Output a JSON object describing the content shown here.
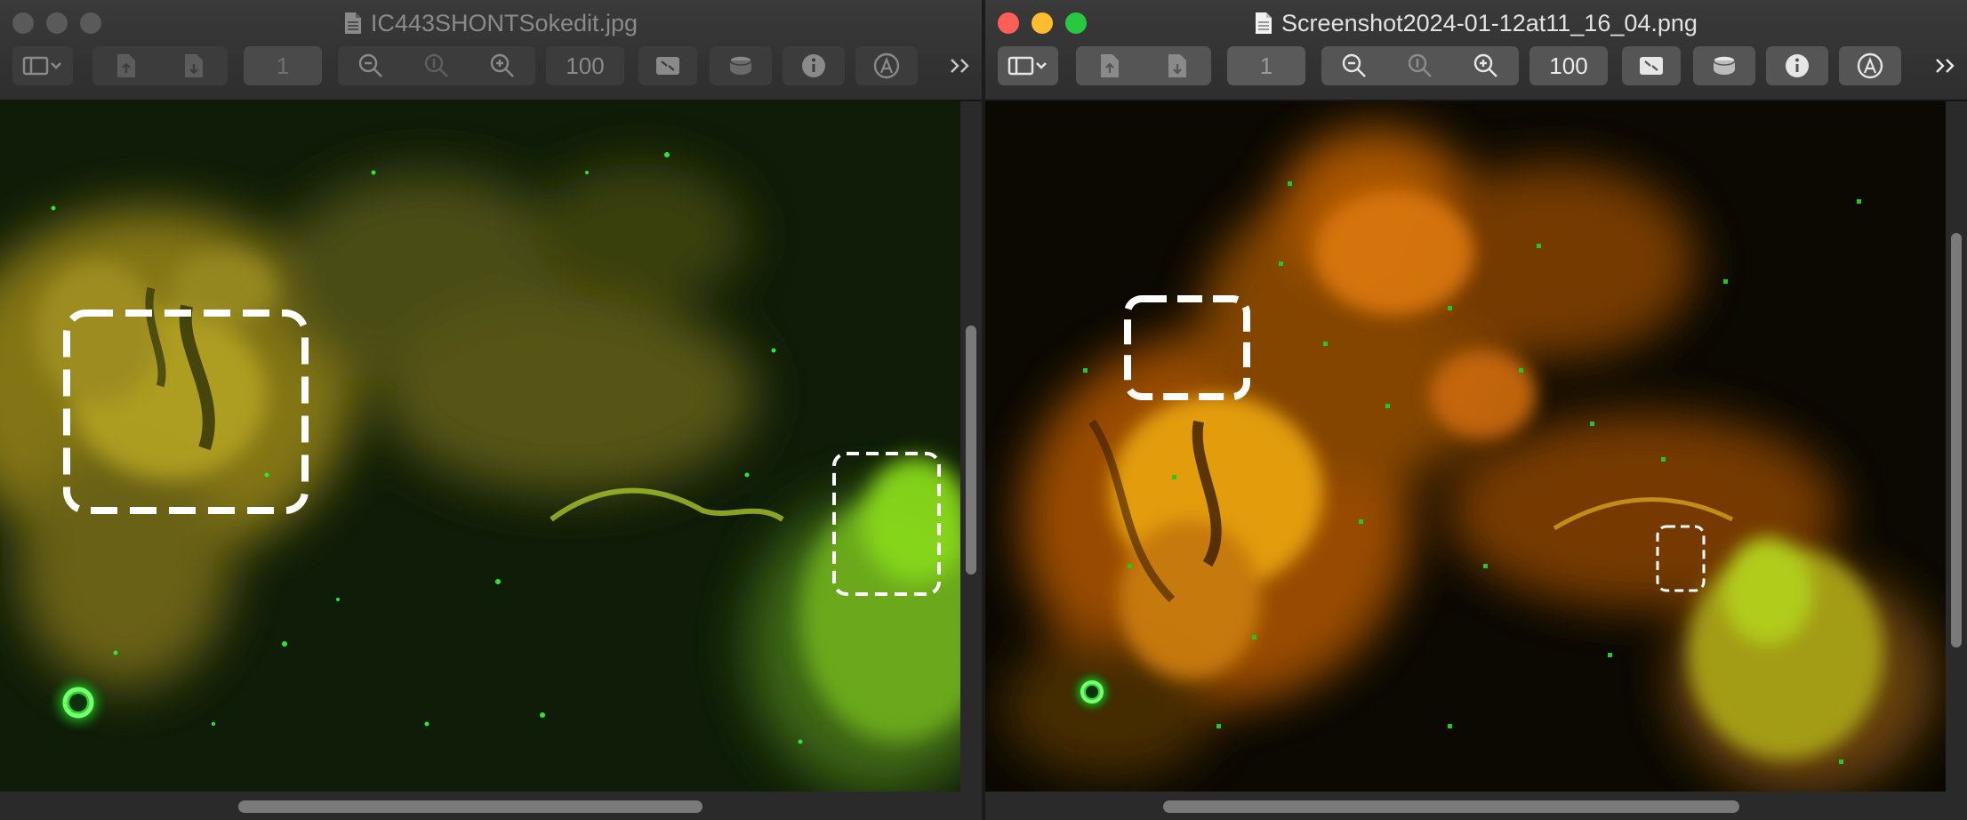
{
  "windows": [
    {
      "id": "left",
      "title": "IC443SHONTSokedit.jpg",
      "active": false,
      "page_number": "1",
      "zoom": "100",
      "colors": {
        "traffic": [
          "#5a5a5a",
          "#5a5a5a",
          "#5a5a5a"
        ],
        "title_text": "#8a8a8a"
      }
    },
    {
      "id": "right",
      "title": "Screenshot2024-01-12at11_16_04.png",
      "active": true,
      "page_number": "1",
      "zoom": "100",
      "colors": {
        "traffic": [
          "#ff5f57",
          "#febc2e",
          "#28c840"
        ],
        "title_text": "#e2e2e2"
      }
    }
  ],
  "toolbar_icons": [
    "sidebar-toggle-icon",
    "rotate-left-icon",
    "rotate-right-icon",
    "zoom-out-icon",
    "actual-size-icon",
    "zoom-in-icon",
    "fit-window-icon",
    "adjust-color-icon",
    "info-icon",
    "markup-icon",
    "overflow-chevron-icon"
  ]
}
